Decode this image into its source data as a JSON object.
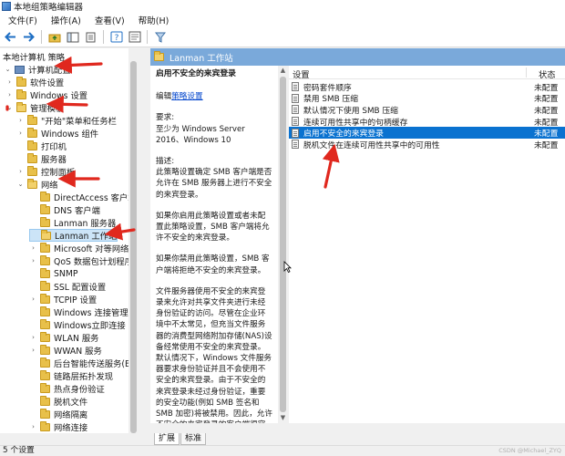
{
  "window": {
    "title": "本地组策略编辑器"
  },
  "menu": [
    "文件(F)",
    "操作(A)",
    "查看(V)",
    "帮助(H)"
  ],
  "toolbar": {
    "icons": [
      "back-icon",
      "forward-icon",
      "up-folder-icon",
      "show-tree-icon",
      "export-icon",
      "help-icon",
      "properties-icon",
      "filter-icon"
    ]
  },
  "tree": {
    "items": [
      {
        "label": "本地计算机 策略",
        "level": 0,
        "expander": "",
        "icon": "policy"
      },
      {
        "label": "计算机配置",
        "level": 0,
        "expander": "v",
        "icon": "computer"
      },
      {
        "label": "软件设置",
        "level": 1,
        "expander": ">",
        "icon": "folder"
      },
      {
        "label": "Windows 设置",
        "level": 1,
        "expander": ">",
        "icon": "folder"
      },
      {
        "label": "管理模板",
        "level": 1,
        "expander": "v",
        "icon": "folder"
      },
      {
        "label": "\"开始\"菜单和任务栏",
        "level": 2,
        "expander": ">",
        "icon": "folder"
      },
      {
        "label": "Windows 组件",
        "level": 2,
        "expander": ">",
        "icon": "folder"
      },
      {
        "label": "打印机",
        "level": 2,
        "expander": "",
        "icon": "folder"
      },
      {
        "label": "服务器",
        "level": 2,
        "expander": "",
        "icon": "folder"
      },
      {
        "label": "控制面板",
        "level": 2,
        "expander": ">",
        "icon": "folder"
      },
      {
        "label": "网络",
        "level": 2,
        "expander": "v",
        "icon": "folder"
      },
      {
        "label": "DirectAccess 客户端体验",
        "level": 3,
        "expander": "",
        "icon": "folder"
      },
      {
        "label": "DNS 客户端",
        "level": 3,
        "expander": "",
        "icon": "folder"
      },
      {
        "label": "Lanman 服务器",
        "level": 3,
        "expander": "",
        "icon": "folder"
      },
      {
        "label": "Lanman 工作站",
        "level": 3,
        "expander": "",
        "icon": "folder",
        "selected": true
      },
      {
        "label": "Microsoft 对等网络服务",
        "level": 3,
        "expander": ">",
        "icon": "folder"
      },
      {
        "label": "QoS 数据包计划程序",
        "level": 3,
        "expander": ">",
        "icon": "folder"
      },
      {
        "label": "SNMP",
        "level": 3,
        "expander": "",
        "icon": "folder"
      },
      {
        "label": "SSL 配置设置",
        "level": 3,
        "expander": "",
        "icon": "folder"
      },
      {
        "label": "TCPIP 设置",
        "level": 3,
        "expander": ">",
        "icon": "folder"
      },
      {
        "label": "Windows 连接管理器",
        "level": 3,
        "expander": "",
        "icon": "folder"
      },
      {
        "label": "Windows立即连接",
        "level": 3,
        "expander": "",
        "icon": "folder"
      },
      {
        "label": "WLAN 服务",
        "level": 3,
        "expander": ">",
        "icon": "folder"
      },
      {
        "label": "WWAN 服务",
        "level": 3,
        "expander": ">",
        "icon": "folder"
      },
      {
        "label": "后台智能传送服务(BITS)",
        "level": 3,
        "expander": "",
        "icon": "folder"
      },
      {
        "label": "链路层拓扑发现",
        "level": 3,
        "expander": "",
        "icon": "folder"
      },
      {
        "label": "热点身份验证",
        "level": 3,
        "expander": "",
        "icon": "folder"
      },
      {
        "label": "脱机文件",
        "level": 3,
        "expander": "",
        "icon": "folder"
      },
      {
        "label": "网络隔离",
        "level": 3,
        "expander": "",
        "icon": "folder"
      },
      {
        "label": "网络连接",
        "level": 3,
        "expander": ">",
        "icon": "folder"
      }
    ]
  },
  "right_header": {
    "title": "Lanman 工作站"
  },
  "description": {
    "title": "启用不安全的来宾登录",
    "edit_prefix": "编辑",
    "edit_link": "策略设置",
    "requirements_label": "要求:",
    "requirements_text": "至少为 Windows Server 2016、Windows 10",
    "desc_label": "描述:",
    "para1": "此策略设置确定 SMB 客户端是否允许在 SMB 服务器上进行不安全的来宾登录。",
    "para2": "如果你启用此策略设置或者未配置此策略设置，SMB 客户端将允许不安全的来宾登录。",
    "para3": "如果你禁用此策略设置，SMB 客户端将拒绝不安全的来宾登录。",
    "para4": "文件服务器使用不安全的来宾登录来允许对共享文件夹进行未经身份验证的访问。尽管在企业环境中不太常见，但充当文件服务器的消费型网络附加存储(NAS)设备经常使用不安全的来宾登录。默认情况下，Windows 文件服务器要求身份验证并且不会使用不安全的来宾登录。由于不安全的来宾登录未经过身份验证，重要的安全功能(例如 SMB 签名和 SMB 加密)将被禁用。因此，允许不安全的来宾登录的客户端很容易受到各种中间人攻"
  },
  "list": {
    "columns": {
      "setting": "设置",
      "state": "状态"
    },
    "rows": [
      {
        "name": "密码套件顺序",
        "state": "未配置"
      },
      {
        "name": "禁用 SMB 压缩",
        "state": "未配置"
      },
      {
        "name": "默认情况下使用 SMB 压缩",
        "state": "未配置"
      },
      {
        "name": "连续可用性共享中的句柄缓存",
        "state": "未配置"
      },
      {
        "name": "启用不安全的来宾登录",
        "state": "未配置",
        "selected": true
      },
      {
        "name": "脱机文件在连续可用性共享中的可用性",
        "state": "未配置"
      }
    ]
  },
  "tabs": [
    "扩展",
    "标准"
  ],
  "status": {
    "text": "5 个设置"
  },
  "watermark": "CSDN @Michael_ZYQ",
  "colors": {
    "annotation": "#e0281e",
    "header_blue": "#7aa9da",
    "selection_blue": "#0a72d0"
  }
}
